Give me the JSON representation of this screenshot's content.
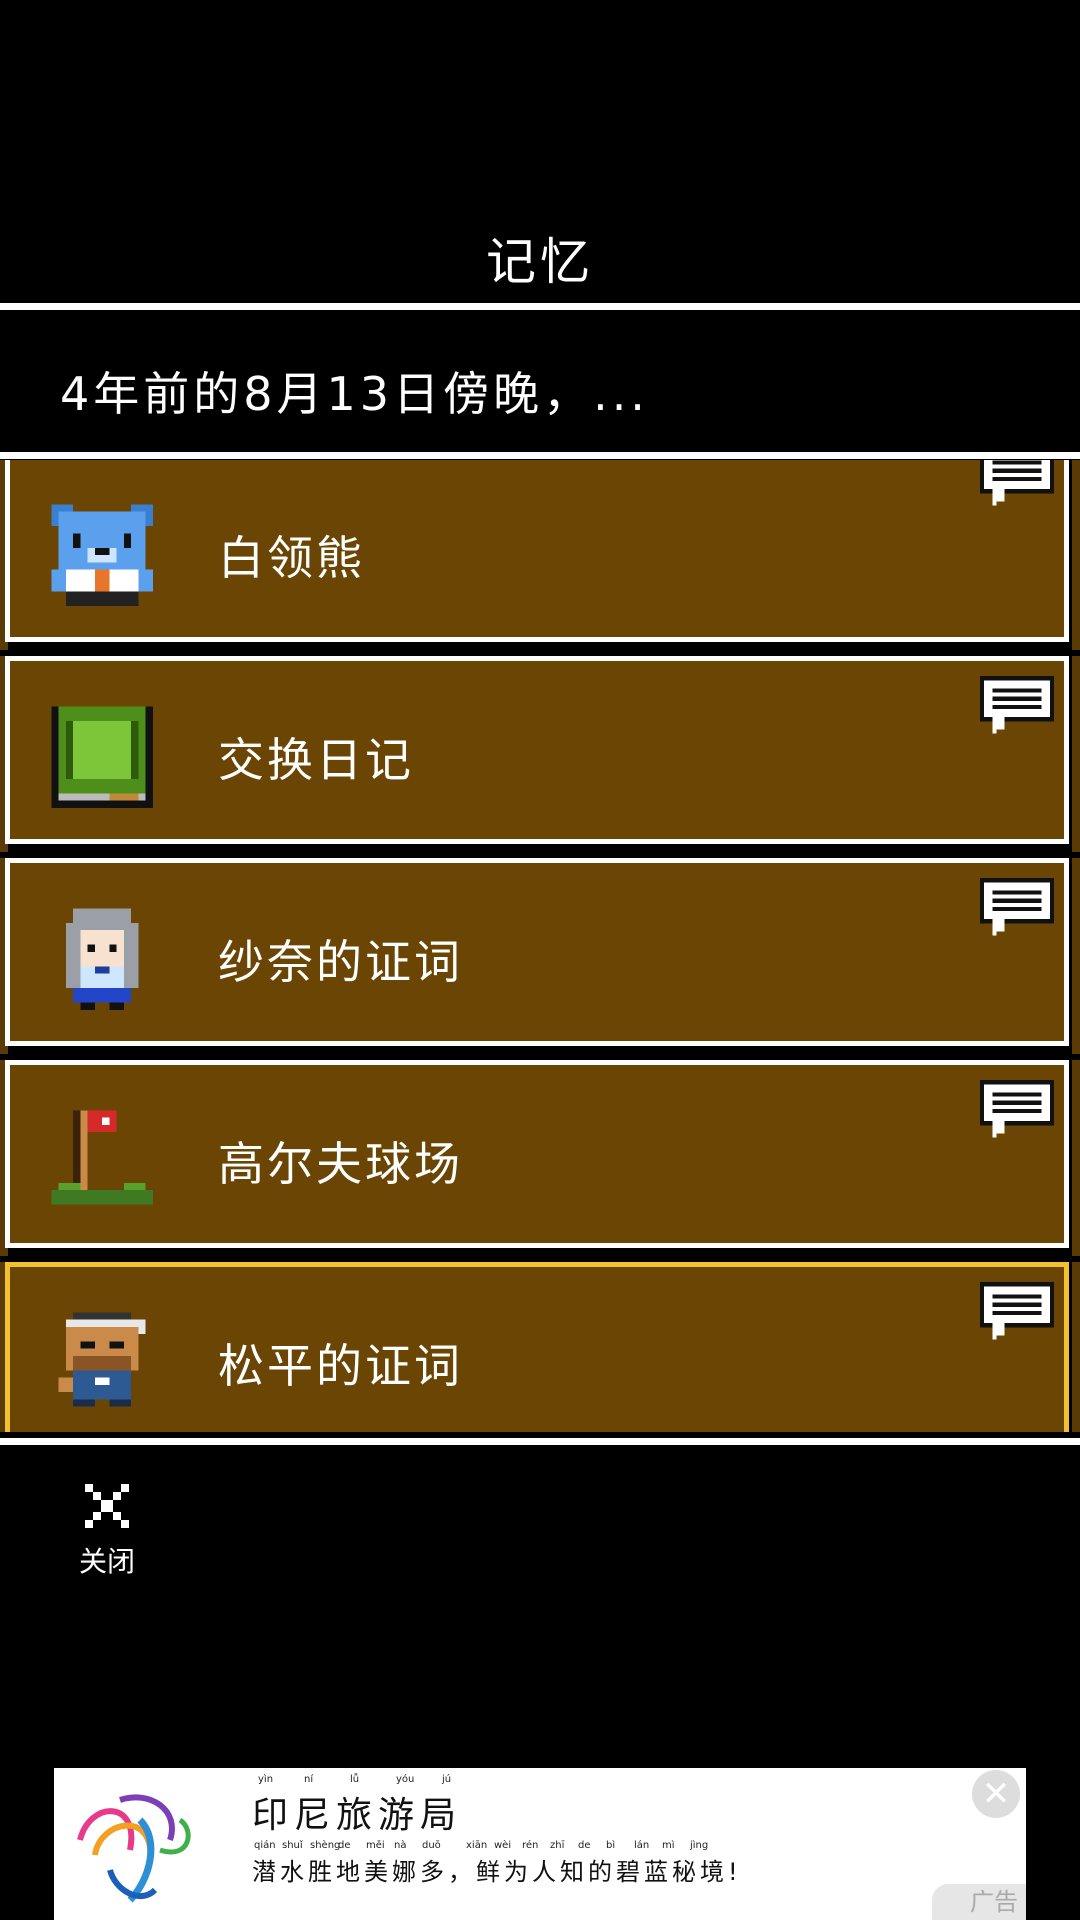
{
  "header": {
    "title": "记忆",
    "subtitle": "4年前的8月13日傍晚，..."
  },
  "items": [
    {
      "label": "白领熊",
      "icon": "bear-icon"
    },
    {
      "label": "交换日记",
      "icon": "diary-icon"
    },
    {
      "label": "纱奈的证词",
      "icon": "girl-icon"
    },
    {
      "label": "高尔夫球场",
      "icon": "golf-flag-icon"
    },
    {
      "label": "松平的证词",
      "icon": "man-icon",
      "selected": true
    }
  ],
  "close": {
    "label": "关闭"
  },
  "ad": {
    "title": "印尼旅游局",
    "description": "潜水胜地美娜多，鲜为人知的碧蓝秘境!",
    "pinyin_title": [
      "yìn",
      "ní",
      "lǚ",
      "yóu",
      "jú"
    ],
    "pinyin_desc": [
      "qián",
      "shuǐ",
      "shèng",
      "de",
      "měi",
      "nà",
      "duō",
      "xiān",
      "wèi",
      "rén",
      "zhī",
      "de",
      "bì",
      "lán",
      "mì",
      "jìng"
    ],
    "badge": "广告",
    "close_symbol": "✕"
  },
  "colors": {
    "card": "#6b4503",
    "card_border": "#ffffff",
    "selected_border": "#f2c12e",
    "background": "#000000"
  }
}
